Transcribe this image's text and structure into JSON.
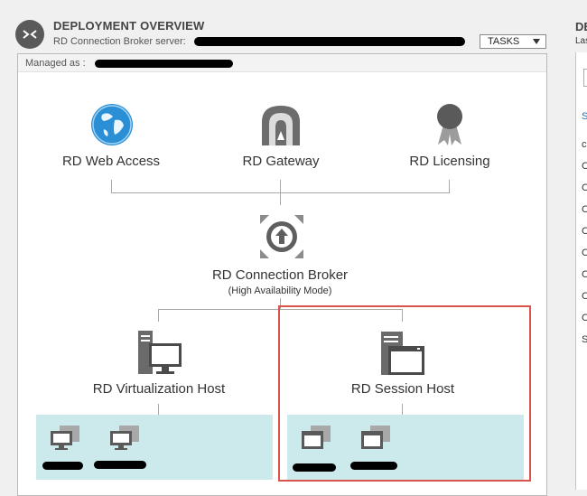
{
  "header": {
    "title": "DEPLOYMENT OVERVIEW",
    "subtitle_prefix": "RD Connection Broker server:",
    "tasks_label": "TASKS"
  },
  "panel": {
    "managed_prefix": "Managed as"
  },
  "roles": {
    "web_access": "RD Web Access",
    "gateway": "RD Gateway",
    "licensing": "RD Licensing",
    "broker": "RD Connection Broker",
    "broker_mode": "(High Availability Mode)",
    "virtualization_host": "RD Virtualization Host",
    "session_host": "RD Session Host"
  },
  "right_panel": {
    "title_fragment": "DE",
    "sub_fragment": "Las",
    "link_fragment": "S",
    "rows": [
      "co",
      "C",
      "C",
      "C",
      "C",
      "C",
      "C",
      "C",
      "C",
      "S"
    ]
  },
  "icons": {
    "header": "deployment-overview-icon",
    "web_access": "globe-icon",
    "gateway": "gateway-arch-icon",
    "licensing": "award-ribbon-icon",
    "broker": "broker-arrow-icon",
    "virtualization_host": "server-monitor-icon",
    "session_host": "server-window-icon"
  },
  "colors": {
    "highlight": "#d9534f",
    "host_box": "#cce9ec",
    "globe": "#2b8fd6"
  }
}
